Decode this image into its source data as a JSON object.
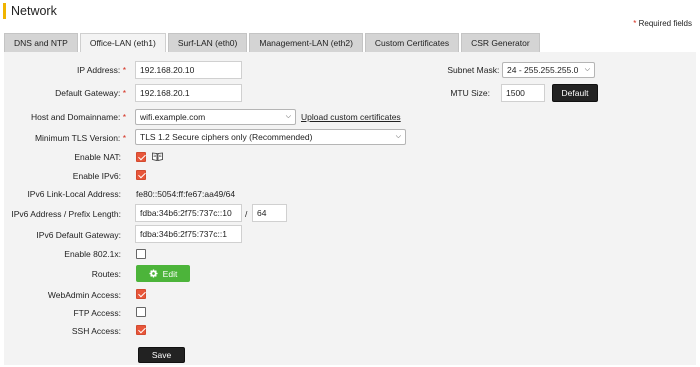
{
  "page": {
    "title": "Network",
    "required_note_star": "*",
    "required_note": " Required fields"
  },
  "tabs": [
    {
      "label": "DNS and NTP",
      "active": false
    },
    {
      "label": "Office-LAN (eth1)",
      "active": true
    },
    {
      "label": "Surf-LAN (eth0)",
      "active": false
    },
    {
      "label": "Management-LAN (eth2)",
      "active": false
    },
    {
      "label": "Custom Certificates",
      "active": false
    },
    {
      "label": "CSR Generator",
      "active": false
    }
  ],
  "form": {
    "ip_address": {
      "label": "IP Address:",
      "star": "*",
      "value": "192.168.20.10"
    },
    "subnet_mask": {
      "label": "Subnet Mask:",
      "star": "*",
      "value": "24 - 255.255.255.0"
    },
    "default_gateway": {
      "label": "Default Gateway:",
      "star": "*",
      "value": "192.168.20.1"
    },
    "mtu_size": {
      "label": "MTU Size:",
      "value": "1500",
      "default_label": "Default"
    },
    "host_domain": {
      "label": "Host and Domainname:",
      "star": "*",
      "value": "wifi.example.com",
      "upload_link": "Upload custom certificates"
    },
    "min_tls": {
      "label": "Minimum TLS Version:",
      "star": "*",
      "value": "TLS 1.2 Secure ciphers only (Recommended)"
    },
    "enable_nat": {
      "label": "Enable NAT:",
      "checked": true,
      "icon": "book-icon"
    },
    "enable_ipv6": {
      "label": "Enable IPv6:",
      "checked": true
    },
    "ipv6_link_local": {
      "label": "IPv6 Link-Local Address:",
      "value": "fe80::5054:ff:fe67:aa49/64"
    },
    "ipv6_prefix": {
      "label": "IPv6 Address / Prefix Length:",
      "address": "fdba:34b6:2f75:737c::10",
      "separator": "/",
      "prefix": "64"
    },
    "ipv6_gateway": {
      "label": "IPv6 Default Gateway:",
      "value": "fdba:34b6:2f75:737c::1"
    },
    "enable_8021x": {
      "label": "Enable 802.1x:",
      "checked": false
    },
    "routes": {
      "label": "Routes:",
      "button": "Edit",
      "icon": "gear-icon"
    },
    "webadmin_access": {
      "label": "WebAdmin Access:",
      "checked": true
    },
    "ftp_access": {
      "label": "FTP Access:",
      "checked": false
    },
    "ssh_access": {
      "label": "SSH Access:",
      "checked": true
    },
    "save_label": "Save"
  },
  "colors": {
    "accent": "#f0b400",
    "required_star": "#d42a1a",
    "checkbox": "#e8563a",
    "edit_button": "#4cb43a",
    "dark_button": "#222222",
    "panel": "#f3f3f3"
  }
}
